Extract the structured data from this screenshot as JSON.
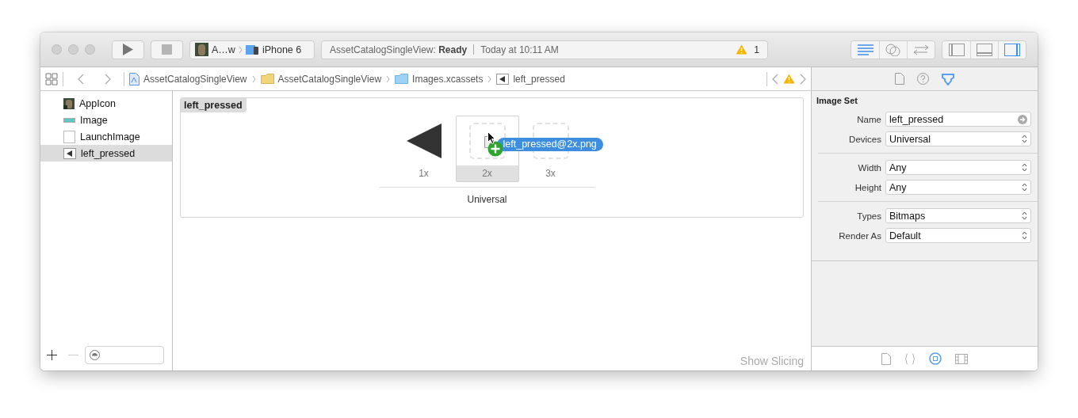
{
  "toolbar": {
    "run_button": {
      "disabled": false
    },
    "stop_button": {
      "disabled": true
    },
    "scheme": {
      "target": "A…w",
      "device": "iPhone 6"
    },
    "activity": {
      "project": "AssetCatalogSingleView:",
      "status": "Ready",
      "time": "Today at 10:11 AM",
      "warning_count": "1"
    },
    "editor_modes": [
      {
        "kind": "standard",
        "selected": true
      },
      {
        "kind": "assistant",
        "selected": false
      },
      {
        "kind": "version",
        "selected": false
      }
    ],
    "panels": [
      {
        "kind": "navigator",
        "selected": false
      },
      {
        "kind": "debug",
        "selected": false
      },
      {
        "kind": "utilities",
        "selected": true
      }
    ]
  },
  "jump_bar": {
    "crumbs": [
      {
        "label": "AssetCatalogSingleView",
        "kind": "project"
      },
      {
        "label": "AssetCatalogSingleView",
        "kind": "folder"
      },
      {
        "label": "Images.xcassets",
        "kind": "assets"
      },
      {
        "label": "left_pressed",
        "kind": "imageset"
      }
    ],
    "has_warning": true
  },
  "sidebar": {
    "items": [
      {
        "label": "AppIcon",
        "kind": "appicon",
        "selected": false
      },
      {
        "label": "Image",
        "kind": "image",
        "selected": false
      },
      {
        "label": "LaunchImage",
        "kind": "launch",
        "selected": false
      },
      {
        "label": "left_pressed",
        "kind": "imageset",
        "selected": true
      }
    ]
  },
  "editor": {
    "set_name": "left_pressed",
    "slots": [
      {
        "scale": "1x",
        "kind": "filled",
        "selected": false
      },
      {
        "scale": "2x",
        "kind": "empty",
        "selected": true
      },
      {
        "scale": "3x",
        "kind": "empty",
        "selected": false
      }
    ],
    "device_label": "Universal",
    "drag_label": "left_pressed@2x.png",
    "show_slicing": "Show Slicing"
  },
  "inspector": {
    "tabs": [
      {
        "kind": "file",
        "selected": false
      },
      {
        "kind": "help",
        "selected": false
      },
      {
        "kind": "attributes",
        "selected": true
      }
    ],
    "title": "Image Set",
    "groups": [
      [
        {
          "label": "Name",
          "value": "left_pressed",
          "kind": "text"
        },
        {
          "label": "Devices",
          "value": "Universal",
          "kind": "select"
        }
      ],
      [
        {
          "label": "Width",
          "value": "Any",
          "kind": "select"
        },
        {
          "label": "Height",
          "value": "Any",
          "kind": "select"
        }
      ],
      [
        {
          "label": "Types",
          "value": "Bitmaps",
          "kind": "select"
        },
        {
          "label": "Render As",
          "value": "Default",
          "kind": "select"
        }
      ]
    ],
    "library_tabs": [
      {
        "kind": "file",
        "selected": false
      },
      {
        "kind": "code",
        "selected": false
      },
      {
        "kind": "object",
        "selected": true
      },
      {
        "kind": "media",
        "selected": false
      }
    ]
  }
}
